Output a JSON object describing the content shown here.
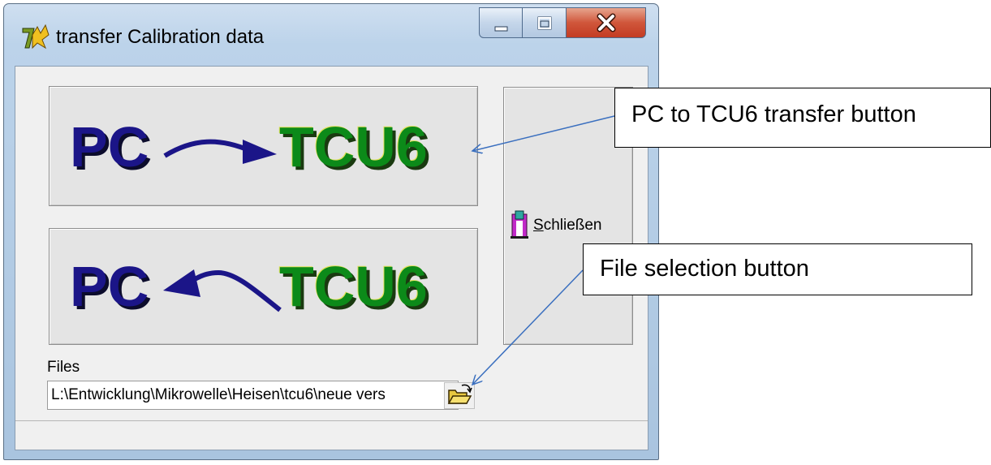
{
  "window": {
    "title": "transfer Calibration data"
  },
  "buttons": {
    "pc_to_tcu": {
      "left": "PC",
      "right": "TCU6"
    },
    "tcu_to_pc": {
      "left": "PC",
      "right": "TCU6"
    },
    "close": {
      "accel": "S",
      "rest": "chließen"
    }
  },
  "files": {
    "label": "Files",
    "path": "L:\\Entwicklung\\Mikrowelle\\Heisen\\tcu6\\neue vers"
  },
  "annotations": {
    "transfer": "PC to TCU6 transfer button",
    "file": "File selection button"
  },
  "icons": {
    "app": "app-icon",
    "minimize": "minimize-icon",
    "maximize": "maximize-icon",
    "close": "close-icon",
    "door": "door-exit-icon",
    "folder": "open-folder-icon"
  },
  "colors": {
    "pc_text": "#1b1588",
    "tcu_text": "#0c8a19",
    "close_button": "#c9452b",
    "arrow": "#3a6fbf"
  }
}
